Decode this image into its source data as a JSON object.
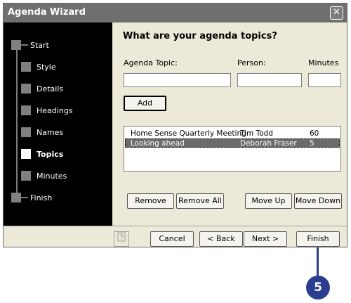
{
  "window": {
    "title": "Agenda Wizard",
    "close_glyph": "✕"
  },
  "steps": [
    {
      "label": "Start"
    },
    {
      "label": "Style"
    },
    {
      "label": "Details"
    },
    {
      "label": "Headings"
    },
    {
      "label": "Names"
    },
    {
      "label": "Topics",
      "active": true
    },
    {
      "label": "Minutes"
    },
    {
      "label": "Finish"
    }
  ],
  "content": {
    "heading": "What are your agenda topics?",
    "labels": {
      "topic": "Agenda Topic:",
      "person": "Person:",
      "minutes": "Minutes"
    },
    "inputs": {
      "topic": "",
      "person": "",
      "minutes": ""
    },
    "add_button": "Add",
    "topics": [
      {
        "topic": "Home Sense Quarterly Meeting",
        "person": "Tim Todd",
        "minutes": "60",
        "selected": false
      },
      {
        "topic": "Looking ahead",
        "person": "Deborah Fraser",
        "minutes": "5",
        "selected": true
      }
    ],
    "buttons": {
      "remove": "Remove",
      "remove_all": "Remove All",
      "move_up": "Move Up",
      "move_down": "Move Down"
    }
  },
  "footer": {
    "cancel": "Cancel",
    "back": "< Back",
    "next": "Next >",
    "finish": "Finish",
    "help_icon": "help-icon"
  },
  "callout": {
    "number": "5"
  },
  "colors": {
    "nav_bg": "#000000",
    "titlebar": "#6f6f6f",
    "dialog_bg": "#ece9d8",
    "callout": "#2a3d8f",
    "selected_row": "#6b6b6b"
  }
}
